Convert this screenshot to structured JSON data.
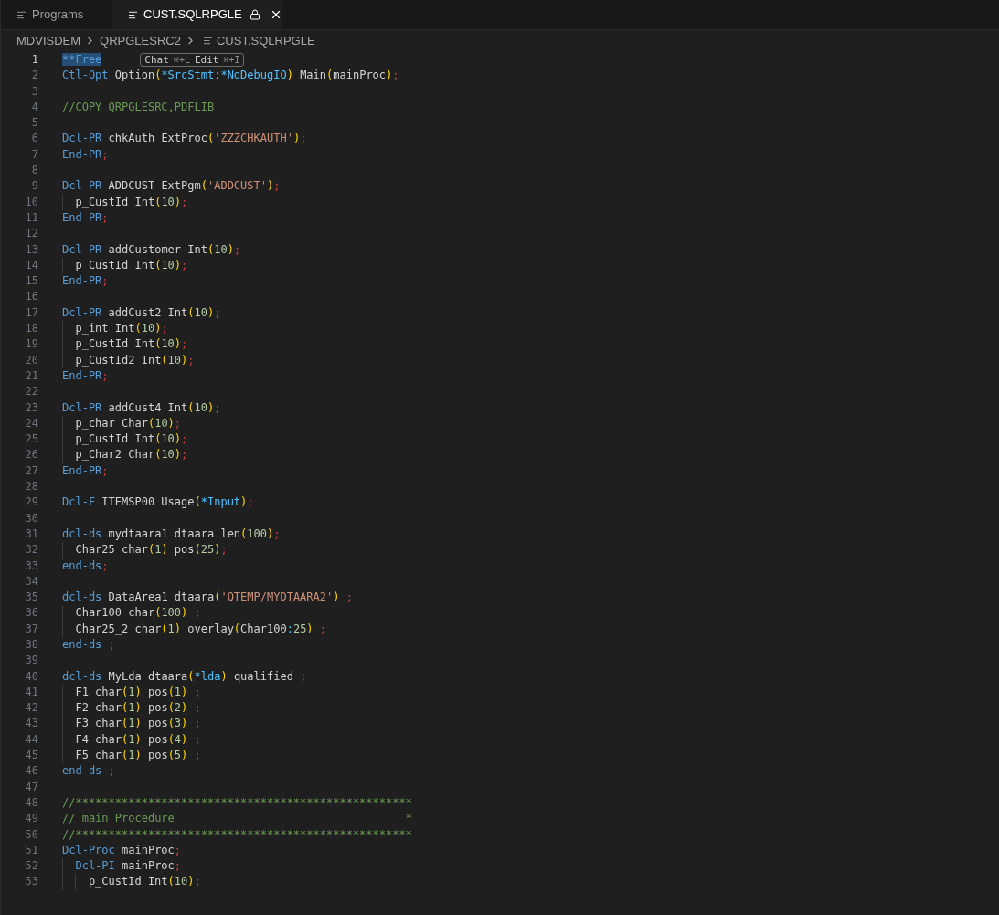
{
  "tabs": [
    {
      "label": "Programs",
      "selected": false,
      "locked": false,
      "closable": false
    },
    {
      "label": "CUST.SQLRPGLE",
      "selected": true,
      "locked": true,
      "closable": true
    }
  ],
  "breadcrumb": [
    {
      "label": "MDVISDEM",
      "kind": "folder"
    },
    {
      "label": "QRPGLESRC2",
      "kind": "folder"
    },
    {
      "label": "CUST.SQLRPGLE",
      "kind": "file"
    }
  ],
  "editor": {
    "lines": [
      {
        "number": "1",
        "current": true,
        "tokens": [
          {
            "kind": "keyword",
            "text": "**Free",
            "selected": true
          }
        ],
        "hint": [
          {
            "label": "Chat",
            "shortcut": "⌘+L"
          },
          {
            "label": "Edit",
            "shortcut": "⌘+I"
          }
        ]
      },
      {
        "number": "2",
        "current": false,
        "tokens": [
          {
            "kind": "keyword",
            "text": "Ctl-Opt"
          },
          {
            "kind": "plain",
            "text": " Option"
          },
          {
            "kind": "bracket",
            "text": "("
          },
          {
            "kind": "constant",
            "text": "*SrcStmt:*NoDebugIO"
          },
          {
            "kind": "bracket",
            "text": ")"
          },
          {
            "kind": "plain",
            "text": " Main"
          },
          {
            "kind": "bracket",
            "text": "("
          },
          {
            "kind": "plain",
            "text": "mainProc"
          },
          {
            "kind": "bracket",
            "text": ")"
          },
          {
            "kind": "punct",
            "text": ";"
          }
        ]
      },
      {
        "number": "3",
        "current": false
      },
      {
        "number": "4",
        "current": false,
        "tokens": [
          {
            "kind": "comment",
            "text": "//COPY QRPGLESRC,PDFLIB"
          }
        ]
      },
      {
        "number": "5",
        "current": false
      },
      {
        "number": "6",
        "current": false,
        "tokens": [
          {
            "kind": "keyword",
            "text": "Dcl-PR"
          },
          {
            "kind": "plain",
            "text": " chkAuth ExtProc"
          },
          {
            "kind": "bracket",
            "text": "("
          },
          {
            "kind": "string",
            "text": "'ZZZCHKAUTH'"
          },
          {
            "kind": "bracket",
            "text": ")"
          },
          {
            "kind": "punct",
            "text": ";"
          }
        ]
      },
      {
        "number": "7",
        "current": false,
        "tokens": [
          {
            "kind": "keyword",
            "text": "End-PR"
          },
          {
            "kind": "punct",
            "text": ";"
          }
        ]
      },
      {
        "number": "8",
        "current": false
      },
      {
        "number": "9",
        "current": false,
        "tokens": [
          {
            "kind": "keyword",
            "text": "Dcl-PR"
          },
          {
            "kind": "plain",
            "text": " ADDCUST ExtPgm"
          },
          {
            "kind": "bracket",
            "text": "("
          },
          {
            "kind": "string",
            "text": "'ADDCUST'"
          },
          {
            "kind": "bracket",
            "text": ")"
          },
          {
            "kind": "punct",
            "text": ";"
          }
        ],
        "children": [
          {
            "number": "10",
            "current": false,
            "tokens": [
              {
                "kind": "plain",
                "text": "p_CustId Int"
              },
              {
                "kind": "bracket",
                "text": "("
              },
              {
                "kind": "number",
                "text": "10"
              },
              {
                "kind": "bracket",
                "text": ")"
              },
              {
                "kind": "punct",
                "text": ";"
              }
            ]
          }
        ]
      },
      {
        "number": "11",
        "current": false,
        "tokens": [
          {
            "kind": "keyword",
            "text": "End-PR"
          },
          {
            "kind": "punct",
            "text": ";"
          }
        ]
      },
      {
        "number": "12",
        "current": false
      },
      {
        "number": "13",
        "current": false,
        "tokens": [
          {
            "kind": "keyword",
            "text": "Dcl-PR"
          },
          {
            "kind": "plain",
            "text": " addCustomer Int"
          },
          {
            "kind": "bracket",
            "text": "("
          },
          {
            "kind": "number",
            "text": "10"
          },
          {
            "kind": "bracket",
            "text": ")"
          },
          {
            "kind": "punct",
            "text": ";"
          }
        ],
        "children": [
          {
            "number": "14",
            "current": false,
            "tokens": [
              {
                "kind": "plain",
                "text": "p_CustId Int"
              },
              {
                "kind": "bracket",
                "text": "("
              },
              {
                "kind": "number",
                "text": "10"
              },
              {
                "kind": "bracket",
                "text": ")"
              },
              {
                "kind": "punct",
                "text": ";"
              }
            ]
          }
        ]
      },
      {
        "number": "15",
        "current": false,
        "tokens": [
          {
            "kind": "keyword",
            "text": "End-PR"
          },
          {
            "kind": "punct",
            "text": ";"
          }
        ]
      },
      {
        "number": "16",
        "current": false
      },
      {
        "number": "17",
        "current": false,
        "tokens": [
          {
            "kind": "keyword",
            "text": "Dcl-PR"
          },
          {
            "kind": "plain",
            "text": " addCust2 Int"
          },
          {
            "kind": "bracket",
            "text": "("
          },
          {
            "kind": "number",
            "text": "10"
          },
          {
            "kind": "bracket",
            "text": ")"
          },
          {
            "kind": "punct",
            "text": ";"
          }
        ],
        "children": [
          {
            "number": "18",
            "current": false,
            "tokens": [
              {
                "kind": "plain",
                "text": "p_int Int"
              },
              {
                "kind": "bracket",
                "text": "("
              },
              {
                "kind": "number",
                "text": "10"
              },
              {
                "kind": "bracket",
                "text": ")"
              },
              {
                "kind": "punct",
                "text": ";"
              }
            ]
          },
          {
            "number": "19",
            "current": false,
            "tokens": [
              {
                "kind": "plain",
                "text": "p_CustId Int"
              },
              {
                "kind": "bracket",
                "text": "("
              },
              {
                "kind": "number",
                "text": "10"
              },
              {
                "kind": "bracket",
                "text": ")"
              },
              {
                "kind": "punct",
                "text": ";"
              }
            ]
          },
          {
            "number": "20",
            "current": false,
            "tokens": [
              {
                "kind": "plain",
                "text": "p_CustId2 Int"
              },
              {
                "kind": "bracket",
                "text": "("
              },
              {
                "kind": "number",
                "text": "10"
              },
              {
                "kind": "bracket",
                "text": ")"
              },
              {
                "kind": "punct",
                "text": ";"
              }
            ]
          }
        ]
      },
      {
        "number": "21",
        "current": false,
        "tokens": [
          {
            "kind": "keyword",
            "text": "End-PR"
          },
          {
            "kind": "punct",
            "text": ";"
          }
        ]
      },
      {
        "number": "22",
        "current": false
      },
      {
        "number": "23",
        "current": false,
        "tokens": [
          {
            "kind": "keyword",
            "text": "Dcl-PR"
          },
          {
            "kind": "plain",
            "text": " addCust4 Int"
          },
          {
            "kind": "bracket",
            "text": "("
          },
          {
            "kind": "number",
            "text": "10"
          },
          {
            "kind": "bracket",
            "text": ")"
          },
          {
            "kind": "punct",
            "text": ";"
          }
        ],
        "children": [
          {
            "number": "24",
            "current": false,
            "tokens": [
              {
                "kind": "plain",
                "text": "p_char Char"
              },
              {
                "kind": "bracket",
                "text": "("
              },
              {
                "kind": "number",
                "text": "10"
              },
              {
                "kind": "bracket",
                "text": ")"
              },
              {
                "kind": "punct",
                "text": ";"
              }
            ]
          },
          {
            "number": "25",
            "current": false,
            "tokens": [
              {
                "kind": "plain",
                "text": "p_CustId Int"
              },
              {
                "kind": "bracket",
                "text": "("
              },
              {
                "kind": "number",
                "text": "10"
              },
              {
                "kind": "bracket",
                "text": ")"
              },
              {
                "kind": "punct",
                "text": ";"
              }
            ]
          },
          {
            "number": "26",
            "current": false,
            "tokens": [
              {
                "kind": "plain",
                "text": "p_Char2 Char"
              },
              {
                "kind": "bracket",
                "text": "("
              },
              {
                "kind": "number",
                "text": "10"
              },
              {
                "kind": "bracket",
                "text": ")"
              },
              {
                "kind": "punct",
                "text": ";"
              }
            ]
          }
        ]
      },
      {
        "number": "27",
        "current": false,
        "tokens": [
          {
            "kind": "keyword",
            "text": "End-PR"
          },
          {
            "kind": "punct",
            "text": ";"
          }
        ]
      },
      {
        "number": "28",
        "current": false
      },
      {
        "number": "29",
        "current": false,
        "tokens": [
          {
            "kind": "keyword",
            "text": "Dcl-F"
          },
          {
            "kind": "plain",
            "text": " ITEMSP00 Usage"
          },
          {
            "kind": "bracket",
            "text": "("
          },
          {
            "kind": "constant",
            "text": "*Input"
          },
          {
            "kind": "bracket",
            "text": ")"
          },
          {
            "kind": "punct",
            "text": ";"
          }
        ]
      },
      {
        "number": "30",
        "current": false
      },
      {
        "number": "31",
        "current": false,
        "tokens": [
          {
            "kind": "keyword",
            "text": "dcl-ds"
          },
          {
            "kind": "plain",
            "text": " mydtaara1 dtaara len"
          },
          {
            "kind": "bracket",
            "text": "("
          },
          {
            "kind": "number",
            "text": "100"
          },
          {
            "kind": "bracket",
            "text": ")"
          },
          {
            "kind": "punct",
            "text": ";"
          }
        ],
        "children": [
          {
            "number": "32",
            "current": false,
            "tokens": [
              {
                "kind": "plain",
                "text": "Char25 char"
              },
              {
                "kind": "bracket",
                "text": "("
              },
              {
                "kind": "number",
                "text": "1"
              },
              {
                "kind": "bracket",
                "text": ")"
              },
              {
                "kind": "plain",
                "text": " pos"
              },
              {
                "kind": "bracket",
                "text": "("
              },
              {
                "kind": "number",
                "text": "25"
              },
              {
                "kind": "bracket",
                "text": ")"
              },
              {
                "kind": "punct",
                "text": ";"
              }
            ]
          }
        ]
      },
      {
        "number": "33",
        "current": false,
        "tokens": [
          {
            "kind": "keyword",
            "text": "end-ds"
          },
          {
            "kind": "punct",
            "text": ";"
          }
        ]
      },
      {
        "number": "34",
        "current": false
      },
      {
        "number": "35",
        "current": false,
        "tokens": [
          {
            "kind": "keyword",
            "text": "dcl-ds"
          },
          {
            "kind": "plain",
            "text": " DataArea1 dtaara"
          },
          {
            "kind": "bracket",
            "text": "("
          },
          {
            "kind": "string",
            "text": "'QTEMP/MYDTAARA2'"
          },
          {
            "kind": "bracket",
            "text": ")"
          },
          {
            "kind": "punct",
            "text": " ;"
          }
        ],
        "children": [
          {
            "number": "36",
            "current": false,
            "tokens": [
              {
                "kind": "plain",
                "text": "Char100 char"
              },
              {
                "kind": "bracket",
                "text": "("
              },
              {
                "kind": "number",
                "text": "100"
              },
              {
                "kind": "bracket",
                "text": ")"
              },
              {
                "kind": "punct",
                "text": " ;"
              }
            ]
          },
          {
            "number": "37",
            "current": false,
            "tokens": [
              {
                "kind": "plain",
                "text": "Char25_2 char"
              },
              {
                "kind": "bracket",
                "text": "("
              },
              {
                "kind": "number",
                "text": "1"
              },
              {
                "kind": "bracket",
                "text": ")"
              },
              {
                "kind": "plain",
                "text": " overlay"
              },
              {
                "kind": "bracket",
                "text": "("
              },
              {
                "kind": "plain",
                "text": "Char100"
              },
              {
                "kind": "constant",
                "text": ":"
              },
              {
                "kind": "number",
                "text": "25"
              },
              {
                "kind": "bracket",
                "text": ")"
              },
              {
                "kind": "punct",
                "text": " ;"
              }
            ]
          }
        ]
      },
      {
        "number": "38",
        "current": false,
        "tokens": [
          {
            "kind": "keyword",
            "text": "end-ds"
          },
          {
            "kind": "punct",
            "text": " ;"
          }
        ]
      },
      {
        "number": "39",
        "current": false
      },
      {
        "number": "40",
        "current": false,
        "tokens": [
          {
            "kind": "keyword",
            "text": "dcl-ds"
          },
          {
            "kind": "plain",
            "text": " MyLda dtaara"
          },
          {
            "kind": "bracket",
            "text": "("
          },
          {
            "kind": "constant",
            "text": "*lda"
          },
          {
            "kind": "bracket",
            "text": ")"
          },
          {
            "kind": "plain",
            "text": " qualified"
          },
          {
            "kind": "punct",
            "text": " ;"
          }
        ],
        "children": [
          {
            "number": "41",
            "current": false,
            "tokens": [
              {
                "kind": "plain",
                "text": "F1 char"
              },
              {
                "kind": "bracket",
                "text": "("
              },
              {
                "kind": "number",
                "text": "1"
              },
              {
                "kind": "bracket",
                "text": ")"
              },
              {
                "kind": "plain",
                "text": " pos"
              },
              {
                "kind": "bracket",
                "text": "("
              },
              {
                "kind": "number",
                "text": "1"
              },
              {
                "kind": "bracket",
                "text": ")"
              },
              {
                "kind": "punct",
                "text": " ;"
              }
            ]
          },
          {
            "number": "42",
            "current": false,
            "tokens": [
              {
                "kind": "plain",
                "text": "F2 char"
              },
              {
                "kind": "bracket",
                "text": "("
              },
              {
                "kind": "number",
                "text": "1"
              },
              {
                "kind": "bracket",
                "text": ")"
              },
              {
                "kind": "plain",
                "text": " pos"
              },
              {
                "kind": "bracket",
                "text": "("
              },
              {
                "kind": "number",
                "text": "2"
              },
              {
                "kind": "bracket",
                "text": ")"
              },
              {
                "kind": "punct",
                "text": " ;"
              }
            ]
          },
          {
            "number": "43",
            "current": false,
            "tokens": [
              {
                "kind": "plain",
                "text": "F3 char"
              },
              {
                "kind": "bracket",
                "text": "("
              },
              {
                "kind": "number",
                "text": "1"
              },
              {
                "kind": "bracket",
                "text": ")"
              },
              {
                "kind": "plain",
                "text": " pos"
              },
              {
                "kind": "bracket",
                "text": "("
              },
              {
                "kind": "number",
                "text": "3"
              },
              {
                "kind": "bracket",
                "text": ")"
              },
              {
                "kind": "punct",
                "text": " ;"
              }
            ]
          },
          {
            "number": "44",
            "current": false,
            "tokens": [
              {
                "kind": "plain",
                "text": "F4 char"
              },
              {
                "kind": "bracket",
                "text": "("
              },
              {
                "kind": "number",
                "text": "1"
              },
              {
                "kind": "bracket",
                "text": ")"
              },
              {
                "kind": "plain",
                "text": " pos"
              },
              {
                "kind": "bracket",
                "text": "("
              },
              {
                "kind": "number",
                "text": "4"
              },
              {
                "kind": "bracket",
                "text": ")"
              },
              {
                "kind": "punct",
                "text": " ;"
              }
            ]
          },
          {
            "number": "45",
            "current": false,
            "tokens": [
              {
                "kind": "plain",
                "text": "F5 char"
              },
              {
                "kind": "bracket",
                "text": "("
              },
              {
                "kind": "number",
                "text": "1"
              },
              {
                "kind": "bracket",
                "text": ")"
              },
              {
                "kind": "plain",
                "text": " pos"
              },
              {
                "kind": "bracket",
                "text": "("
              },
              {
                "kind": "number",
                "text": "5"
              },
              {
                "kind": "bracket",
                "text": ")"
              },
              {
                "kind": "punct",
                "text": " ;"
              }
            ]
          }
        ]
      },
      {
        "number": "46",
        "current": false,
        "tokens": [
          {
            "kind": "keyword",
            "text": "end-ds"
          },
          {
            "kind": "punct",
            "text": " ;"
          }
        ]
      },
      {
        "number": "47",
        "current": false
      },
      {
        "number": "48",
        "current": false,
        "tokens": [
          {
            "kind": "comment",
            "text": "//***************************************************"
          }
        ]
      },
      {
        "number": "49",
        "current": false,
        "tokens": [
          {
            "kind": "comment",
            "text": "// main Procedure                                   *"
          }
        ]
      },
      {
        "number": "50",
        "current": false,
        "tokens": [
          {
            "kind": "comment",
            "text": "//***************************************************"
          }
        ]
      },
      {
        "number": "51",
        "current": false,
        "tokens": [
          {
            "kind": "keyword",
            "text": "Dcl-Proc"
          },
          {
            "kind": "plain",
            "text": " mainProc"
          },
          {
            "kind": "punct",
            "text": ";"
          }
        ],
        "children": [
          {
            "number": "52",
            "current": false,
            "tokens": [
              {
                "kind": "keyword",
                "text": "Dcl-PI"
              },
              {
                "kind": "plain",
                "text": " mainProc"
              },
              {
                "kind": "punct",
                "text": ";"
              }
            ],
            "children": [
              {
                "number": "53",
                "current": false,
                "tokens": [
                  {
                    "kind": "plain",
                    "text": "p_CustId Int"
                  },
                  {
                    "kind": "bracket",
                    "text": "("
                  },
                  {
                    "kind": "number",
                    "text": "10"
                  },
                  {
                    "kind": "bracket",
                    "text": ")"
                  },
                  {
                    "kind": "punct",
                    "text": ";"
                  }
                ]
              }
            ]
          }
        ]
      }
    ]
  }
}
